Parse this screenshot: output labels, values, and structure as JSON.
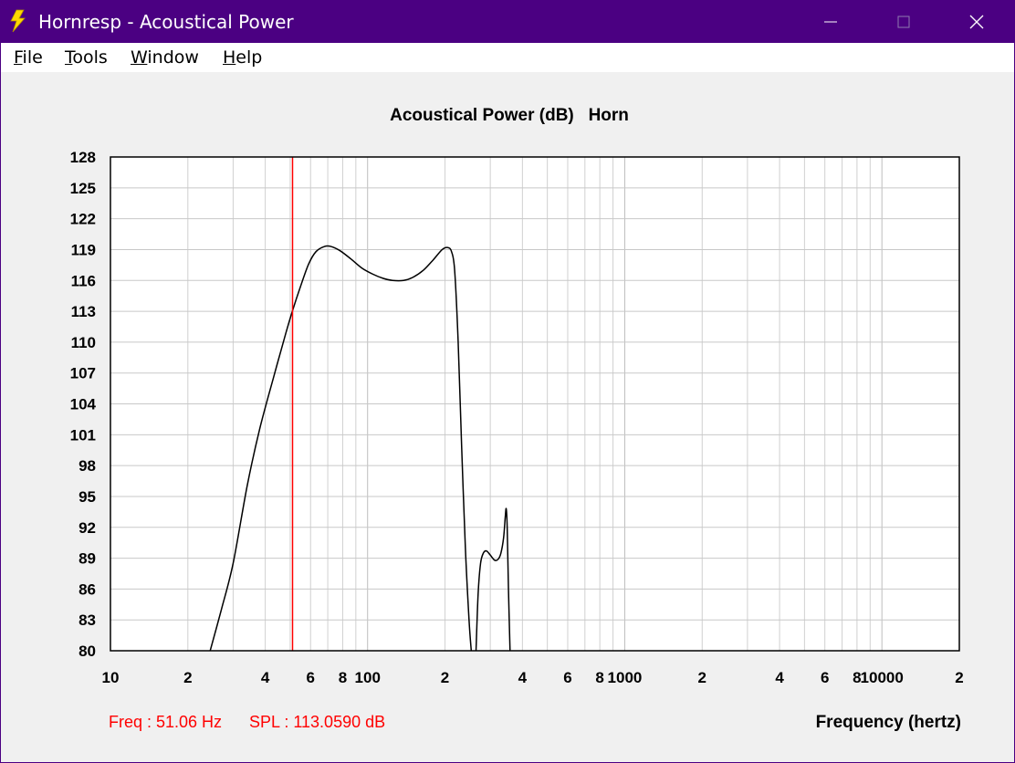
{
  "window": {
    "title": "Hornresp - Acoustical Power",
    "title_bar_color": "#4b0082",
    "controls": {
      "minimize": "minimize-icon",
      "maximize": "maximize-icon",
      "close": "close-icon"
    }
  },
  "menu": {
    "items": [
      {
        "label": "File",
        "accel": "F",
        "rest": "ile"
      },
      {
        "label": "Tools",
        "accel": "T",
        "rest": "ools"
      },
      {
        "label": "Window",
        "accel": "W",
        "rest": "indow"
      },
      {
        "label": "Help",
        "accel": "H",
        "rest": "elp"
      }
    ]
  },
  "chart_data": {
    "type": "line",
    "title": "Acoustical Power (dB)   Horn",
    "xlabel": "Frequency (hertz)",
    "ylabel": "",
    "xscale": "log",
    "xlim": [
      10,
      20000
    ],
    "ylim": [
      80,
      128
    ],
    "yticks": [
      128,
      125,
      122,
      119,
      116,
      113,
      110,
      107,
      104,
      101,
      98,
      95,
      92,
      89,
      86,
      83,
      80
    ],
    "xtick_labels": [
      {
        "x": 10,
        "label": "10"
      },
      {
        "x": 20,
        "label": "2"
      },
      {
        "x": 40,
        "label": "4"
      },
      {
        "x": 60,
        "label": "6"
      },
      {
        "x": 80,
        "label": "8"
      },
      {
        "x": 100,
        "label": "100"
      },
      {
        "x": 200,
        "label": "2"
      },
      {
        "x": 400,
        "label": "4"
      },
      {
        "x": 600,
        "label": "6"
      },
      {
        "x": 800,
        "label": "8"
      },
      {
        "x": 1000,
        "label": "1000"
      },
      {
        "x": 2000,
        "label": "2"
      },
      {
        "x": 4000,
        "label": "4"
      },
      {
        "x": 6000,
        "label": "6"
      },
      {
        "x": 8000,
        "label": "8"
      },
      {
        "x": 10000,
        "label": "10000"
      },
      {
        "x": 20000,
        "label": "2"
      }
    ],
    "grid": true,
    "cursor": {
      "freq_hz": 51.06,
      "color": "#ff0000"
    },
    "series": [
      {
        "color": "#000000",
        "points": [
          [
            24.3,
            79.8
          ],
          [
            27,
            84
          ],
          [
            30,
            88.5
          ],
          [
            34,
            96
          ],
          [
            38,
            101.5
          ],
          [
            43,
            106.5
          ],
          [
            48,
            110.8
          ],
          [
            51.06,
            113.06
          ],
          [
            55,
            115.5
          ],
          [
            59,
            117.6
          ],
          [
            63,
            118.8
          ],
          [
            68,
            119.3
          ],
          [
            72,
            119.3
          ],
          [
            78,
            118.9
          ],
          [
            86,
            118.1
          ],
          [
            95,
            117.2
          ],
          [
            105,
            116.6
          ],
          [
            115,
            116.2
          ],
          [
            125,
            116.0
          ],
          [
            138,
            116.0
          ],
          [
            150,
            116.3
          ],
          [
            165,
            117.0
          ],
          [
            180,
            118.0
          ],
          [
            195,
            119.0
          ],
          [
            205,
            119.2
          ],
          [
            212,
            118.8
          ],
          [
            218,
            117.0
          ],
          [
            225,
            110.0
          ],
          [
            232,
            100.0
          ],
          [
            240,
            90.0
          ],
          [
            248,
            83.0
          ],
          [
            253,
            80.0
          ]
        ]
      },
      {
        "color": "#000000",
        "points": [
          [
            264,
            80.0
          ],
          [
            269,
            85.5
          ],
          [
            275,
            88.5
          ],
          [
            282,
            89.5
          ],
          [
            290,
            89.7
          ],
          [
            300,
            89.3
          ],
          [
            312,
            88.8
          ],
          [
            322,
            88.9
          ],
          [
            330,
            89.5
          ],
          [
            338,
            91.0
          ],
          [
            343,
            93.0
          ],
          [
            346,
            93.8
          ],
          [
            349,
            92.0
          ],
          [
            353,
            86.0
          ],
          [
            358,
            80.0
          ]
        ]
      }
    ]
  },
  "status": {
    "freq_label": "Freq : 51.06 Hz",
    "spl_label": "SPL : 113.0590 dB",
    "color": "#ff0000"
  }
}
